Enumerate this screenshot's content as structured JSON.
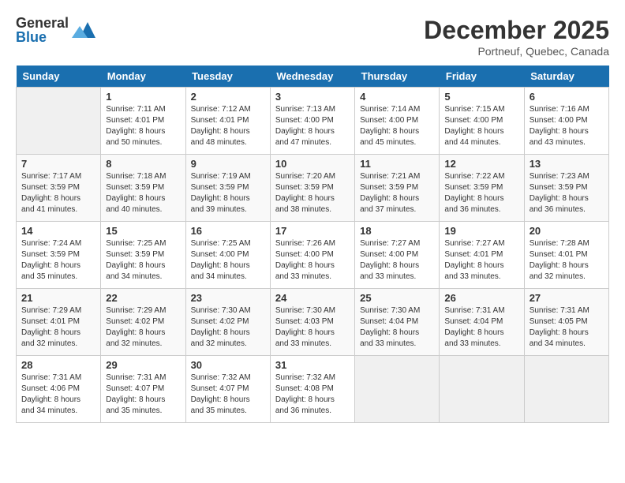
{
  "header": {
    "logo_general": "General",
    "logo_blue": "Blue",
    "month_title": "December 2025",
    "location": "Portneuf, Quebec, Canada"
  },
  "days_of_week": [
    "Sunday",
    "Monday",
    "Tuesday",
    "Wednesday",
    "Thursday",
    "Friday",
    "Saturday"
  ],
  "weeks": [
    [
      {
        "day": "",
        "info": ""
      },
      {
        "day": "1",
        "info": "Sunrise: 7:11 AM\nSunset: 4:01 PM\nDaylight: 8 hours\nand 50 minutes."
      },
      {
        "day": "2",
        "info": "Sunrise: 7:12 AM\nSunset: 4:01 PM\nDaylight: 8 hours\nand 48 minutes."
      },
      {
        "day": "3",
        "info": "Sunrise: 7:13 AM\nSunset: 4:00 PM\nDaylight: 8 hours\nand 47 minutes."
      },
      {
        "day": "4",
        "info": "Sunrise: 7:14 AM\nSunset: 4:00 PM\nDaylight: 8 hours\nand 45 minutes."
      },
      {
        "day": "5",
        "info": "Sunrise: 7:15 AM\nSunset: 4:00 PM\nDaylight: 8 hours\nand 44 minutes."
      },
      {
        "day": "6",
        "info": "Sunrise: 7:16 AM\nSunset: 4:00 PM\nDaylight: 8 hours\nand 43 minutes."
      }
    ],
    [
      {
        "day": "7",
        "info": "Sunrise: 7:17 AM\nSunset: 3:59 PM\nDaylight: 8 hours\nand 41 minutes."
      },
      {
        "day": "8",
        "info": "Sunrise: 7:18 AM\nSunset: 3:59 PM\nDaylight: 8 hours\nand 40 minutes."
      },
      {
        "day": "9",
        "info": "Sunrise: 7:19 AM\nSunset: 3:59 PM\nDaylight: 8 hours\nand 39 minutes."
      },
      {
        "day": "10",
        "info": "Sunrise: 7:20 AM\nSunset: 3:59 PM\nDaylight: 8 hours\nand 38 minutes."
      },
      {
        "day": "11",
        "info": "Sunrise: 7:21 AM\nSunset: 3:59 PM\nDaylight: 8 hours\nand 37 minutes."
      },
      {
        "day": "12",
        "info": "Sunrise: 7:22 AM\nSunset: 3:59 PM\nDaylight: 8 hours\nand 36 minutes."
      },
      {
        "day": "13",
        "info": "Sunrise: 7:23 AM\nSunset: 3:59 PM\nDaylight: 8 hours\nand 36 minutes."
      }
    ],
    [
      {
        "day": "14",
        "info": "Sunrise: 7:24 AM\nSunset: 3:59 PM\nDaylight: 8 hours\nand 35 minutes."
      },
      {
        "day": "15",
        "info": "Sunrise: 7:25 AM\nSunset: 3:59 PM\nDaylight: 8 hours\nand 34 minutes."
      },
      {
        "day": "16",
        "info": "Sunrise: 7:25 AM\nSunset: 4:00 PM\nDaylight: 8 hours\nand 34 minutes."
      },
      {
        "day": "17",
        "info": "Sunrise: 7:26 AM\nSunset: 4:00 PM\nDaylight: 8 hours\nand 33 minutes."
      },
      {
        "day": "18",
        "info": "Sunrise: 7:27 AM\nSunset: 4:00 PM\nDaylight: 8 hours\nand 33 minutes."
      },
      {
        "day": "19",
        "info": "Sunrise: 7:27 AM\nSunset: 4:01 PM\nDaylight: 8 hours\nand 33 minutes."
      },
      {
        "day": "20",
        "info": "Sunrise: 7:28 AM\nSunset: 4:01 PM\nDaylight: 8 hours\nand 32 minutes."
      }
    ],
    [
      {
        "day": "21",
        "info": "Sunrise: 7:29 AM\nSunset: 4:01 PM\nDaylight: 8 hours\nand 32 minutes."
      },
      {
        "day": "22",
        "info": "Sunrise: 7:29 AM\nSunset: 4:02 PM\nDaylight: 8 hours\nand 32 minutes."
      },
      {
        "day": "23",
        "info": "Sunrise: 7:30 AM\nSunset: 4:02 PM\nDaylight: 8 hours\nand 32 minutes."
      },
      {
        "day": "24",
        "info": "Sunrise: 7:30 AM\nSunset: 4:03 PM\nDaylight: 8 hours\nand 33 minutes."
      },
      {
        "day": "25",
        "info": "Sunrise: 7:30 AM\nSunset: 4:04 PM\nDaylight: 8 hours\nand 33 minutes."
      },
      {
        "day": "26",
        "info": "Sunrise: 7:31 AM\nSunset: 4:04 PM\nDaylight: 8 hours\nand 33 minutes."
      },
      {
        "day": "27",
        "info": "Sunrise: 7:31 AM\nSunset: 4:05 PM\nDaylight: 8 hours\nand 34 minutes."
      }
    ],
    [
      {
        "day": "28",
        "info": "Sunrise: 7:31 AM\nSunset: 4:06 PM\nDaylight: 8 hours\nand 34 minutes."
      },
      {
        "day": "29",
        "info": "Sunrise: 7:31 AM\nSunset: 4:07 PM\nDaylight: 8 hours\nand 35 minutes."
      },
      {
        "day": "30",
        "info": "Sunrise: 7:32 AM\nSunset: 4:07 PM\nDaylight: 8 hours\nand 35 minutes."
      },
      {
        "day": "31",
        "info": "Sunrise: 7:32 AM\nSunset: 4:08 PM\nDaylight: 8 hours\nand 36 minutes."
      },
      {
        "day": "",
        "info": ""
      },
      {
        "day": "",
        "info": ""
      },
      {
        "day": "",
        "info": ""
      }
    ]
  ]
}
